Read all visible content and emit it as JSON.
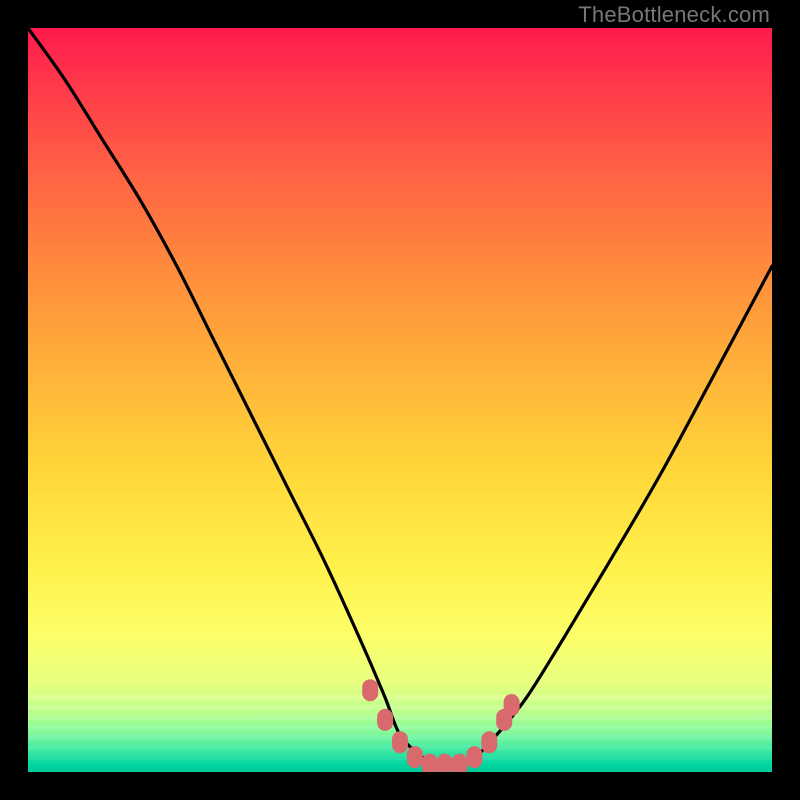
{
  "watermark": {
    "text": "TheBottleneck.com"
  },
  "chart_data": {
    "type": "line",
    "title": "",
    "xlabel": "",
    "ylabel": "",
    "xlim": [
      0,
      100
    ],
    "ylim": [
      0,
      100
    ],
    "grid": false,
    "legend": null,
    "series": [
      {
        "name": "bottleneck-curve",
        "x": [
          0,
          5,
          10,
          15,
          20,
          25,
          30,
          35,
          40,
          45,
          48,
          50,
          53,
          55,
          57,
          60,
          63,
          67,
          72,
          78,
          85,
          92,
          100
        ],
        "values": [
          100,
          93,
          85,
          77,
          68,
          58,
          48,
          38,
          28,
          17,
          10,
          5,
          2,
          1,
          1,
          2,
          5,
          10,
          18,
          28,
          40,
          53,
          68
        ]
      }
    ],
    "annotations": {
      "valley_markers": {
        "color": "#d86a6e",
        "points": [
          {
            "x": 46,
            "y": 11
          },
          {
            "x": 48,
            "y": 7
          },
          {
            "x": 50,
            "y": 4
          },
          {
            "x": 52,
            "y": 2
          },
          {
            "x": 54,
            "y": 1
          },
          {
            "x": 56,
            "y": 1
          },
          {
            "x": 58,
            "y": 1
          },
          {
            "x": 60,
            "y": 2
          },
          {
            "x": 62,
            "y": 4
          },
          {
            "x": 64,
            "y": 7
          },
          {
            "x": 65,
            "y": 9
          }
        ]
      }
    },
    "background_gradient": {
      "top": "#ff1a4d",
      "mid": "#fff04a",
      "bottom": "#00c89a"
    }
  }
}
